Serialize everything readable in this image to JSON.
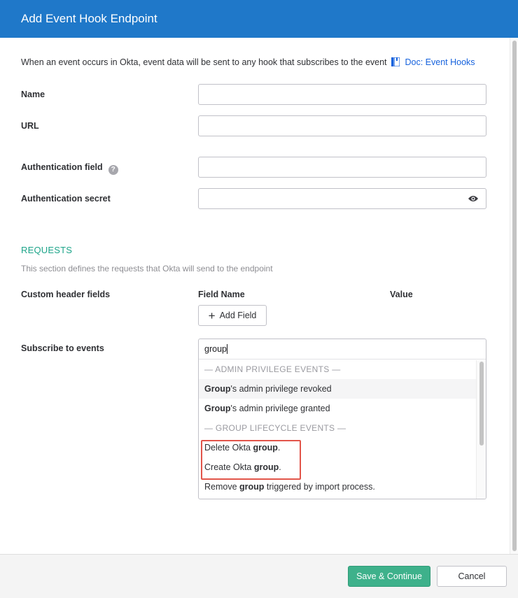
{
  "dialog": {
    "title": "Add Event Hook Endpoint"
  },
  "intro": {
    "text": "When an event occurs in Okta, event data will be sent to any hook that subscribes to the event",
    "doc_link": "Doc: Event Hooks"
  },
  "form": {
    "name_label": "Name",
    "name_value": "",
    "url_label": "URL",
    "url_value": "",
    "auth_field_label": "Authentication field",
    "auth_field_value": "",
    "auth_secret_label": "Authentication secret",
    "auth_secret_value": ""
  },
  "requests": {
    "title": "REQUESTS",
    "description": "This section defines the requests that Okta will send to the endpoint",
    "custom_header_label": "Custom header fields",
    "field_name_col": "Field Name",
    "value_col": "Value",
    "add_field_button": "Add Field"
  },
  "subscribe": {
    "label": "Subscribe to events",
    "query": "group",
    "groups": [
      {
        "heading": "— ADMIN PRIVILEGE EVENTS —",
        "options": [
          {
            "bold": "Group",
            "rest": "'s admin privilege revoked",
            "pre": ""
          },
          {
            "bold": "Group",
            "rest": "'s admin privilege granted",
            "pre": ""
          }
        ]
      },
      {
        "heading": "— GROUP LIFECYCLE EVENTS —",
        "options": [
          {
            "pre": "Delete Okta ",
            "bold": "group",
            "rest": "."
          },
          {
            "pre": "Create Okta ",
            "bold": "group",
            "rest": "."
          },
          {
            "pre": "Remove ",
            "bold": "group",
            "rest": " triggered by import process."
          }
        ]
      }
    ]
  },
  "footer": {
    "save_button": "Save & Continue",
    "cancel_button": "Cancel"
  },
  "colors": {
    "header": "#1f78c9",
    "accent_green": "#3eb18b",
    "highlight_red": "#e2554a",
    "link_blue": "#1662dd"
  },
  "icons": {
    "doc": "book-icon",
    "help": "help-icon",
    "reveal": "eye-icon",
    "add": "plus-icon"
  }
}
